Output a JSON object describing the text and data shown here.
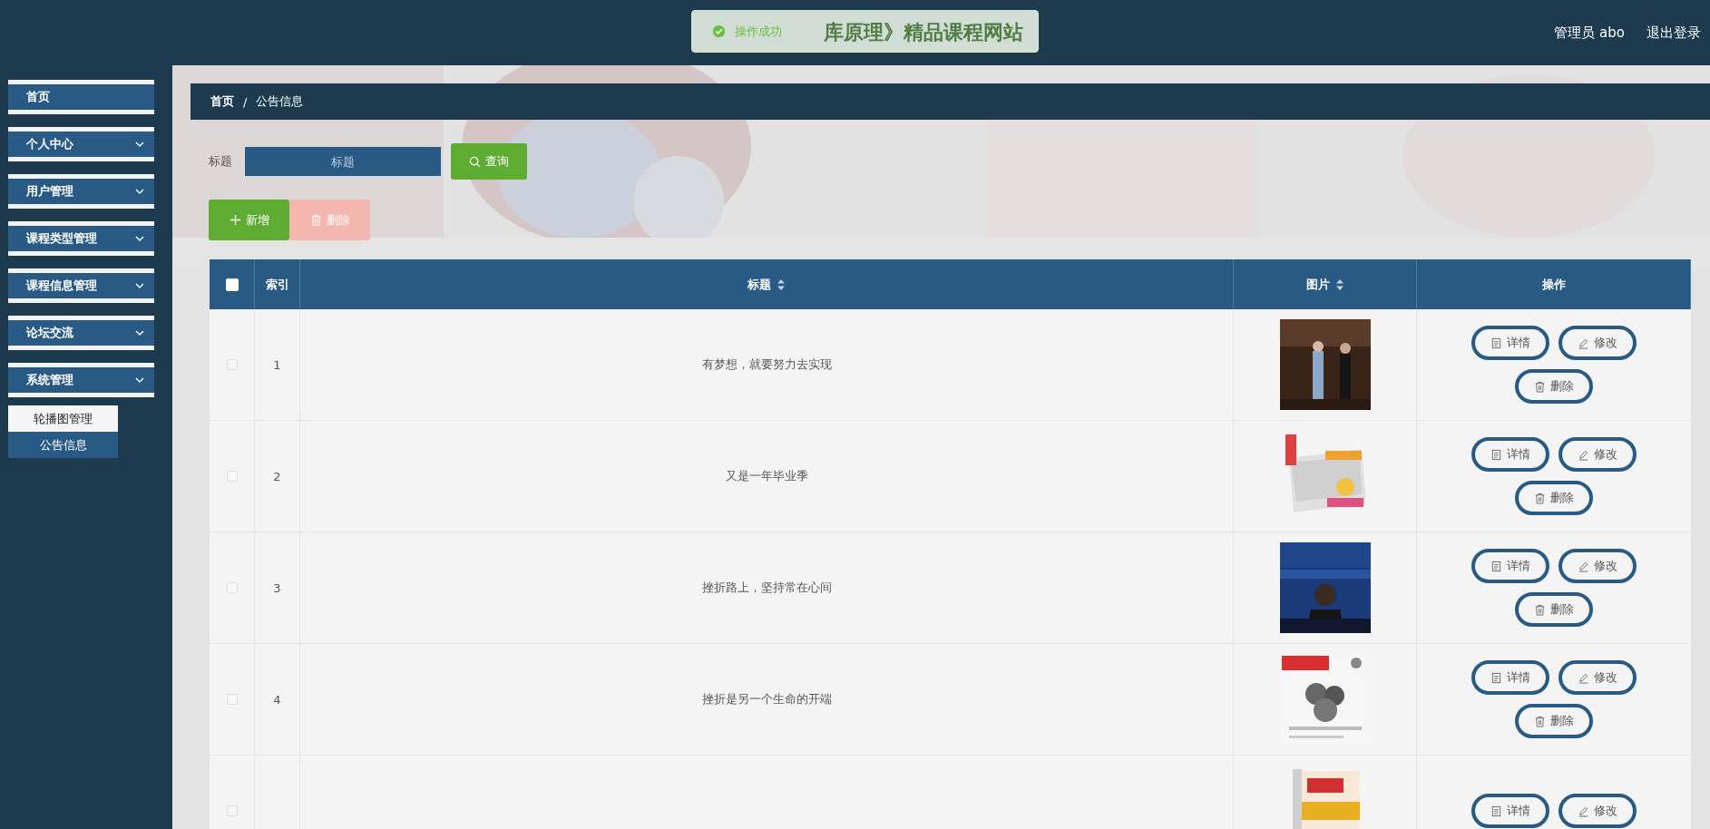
{
  "header": {
    "title": "库原理》精品课程网站",
    "user": "管理员 abo",
    "logout": "退出登录"
  },
  "toast": {
    "kind": "success",
    "text": "操作成功"
  },
  "sidebar": {
    "items": [
      {
        "label": "首页",
        "expandable": false
      },
      {
        "label": "个人中心",
        "expandable": true
      },
      {
        "label": "用户管理",
        "expandable": true
      },
      {
        "label": "课程类型管理",
        "expandable": true
      },
      {
        "label": "课程信息管理",
        "expandable": true
      },
      {
        "label": "论坛交流",
        "expandable": true
      },
      {
        "label": "系统管理",
        "expandable": true,
        "children": [
          {
            "label": "轮播图管理",
            "highlighted": true
          },
          {
            "label": "公告信息",
            "highlighted": false
          }
        ]
      }
    ]
  },
  "breadcrumb": {
    "items": [
      "首页",
      "公告信息"
    ],
    "separator": "/"
  },
  "search": {
    "label": "标题",
    "placeholder": "标题",
    "button": "查询"
  },
  "actions": [
    {
      "label": "新增",
      "kind": "add",
      "disabled": false
    },
    {
      "label": "删除",
      "kind": "delete",
      "disabled": true
    }
  ],
  "table": {
    "select_all": {
      "checked": false
    },
    "columns": [
      {
        "label": "索引",
        "sortable": false
      },
      {
        "label": "标题",
        "sortable": true
      },
      {
        "label": "图片",
        "sortable": true
      },
      {
        "label": "操作",
        "sortable": false
      }
    ],
    "rows": [
      {
        "checked": false,
        "index": "1",
        "title": "有梦想，就要努力去实现",
        "picture": {
          "kind": "picture"
        },
        "actions": [
          {
            "label": "详情",
            "kind": "detail"
          },
          {
            "label": "修改",
            "kind": "edit"
          },
          {
            "label": "删除",
            "kind": "delete"
          }
        ]
      },
      {
        "checked": false,
        "index": "2",
        "title": "又是一年毕业季",
        "picture": {
          "kind": "picture"
        },
        "actions": [
          {
            "label": "详情",
            "kind": "detail"
          },
          {
            "label": "修改",
            "kind": "edit"
          },
          {
            "label": "删除",
            "kind": "delete"
          }
        ]
      },
      {
        "checked": false,
        "index": "3",
        "title": "挫折路上，坚持常在心间",
        "picture": {
          "kind": "picture"
        },
        "actions": [
          {
            "label": "详情",
            "kind": "detail"
          },
          {
            "label": "修改",
            "kind": "edit"
          },
          {
            "label": "删除",
            "kind": "delete"
          }
        ]
      },
      {
        "checked": false,
        "index": "4",
        "title": "挫折是另一个生命的开端",
        "picture": {
          "kind": "picture"
        },
        "actions": [
          {
            "label": "详情",
            "kind": "detail"
          },
          {
            "label": "修改",
            "kind": "edit"
          },
          {
            "label": "删除",
            "kind": "delete"
          }
        ]
      },
      {
        "checked": false,
        "picture": {
          "kind": "picture"
        },
        "actions": [
          {
            "label": "详情",
            "kind": "detail"
          },
          {
            "label": "修改",
            "kind": "edit"
          }
        ]
      }
    ]
  }
}
